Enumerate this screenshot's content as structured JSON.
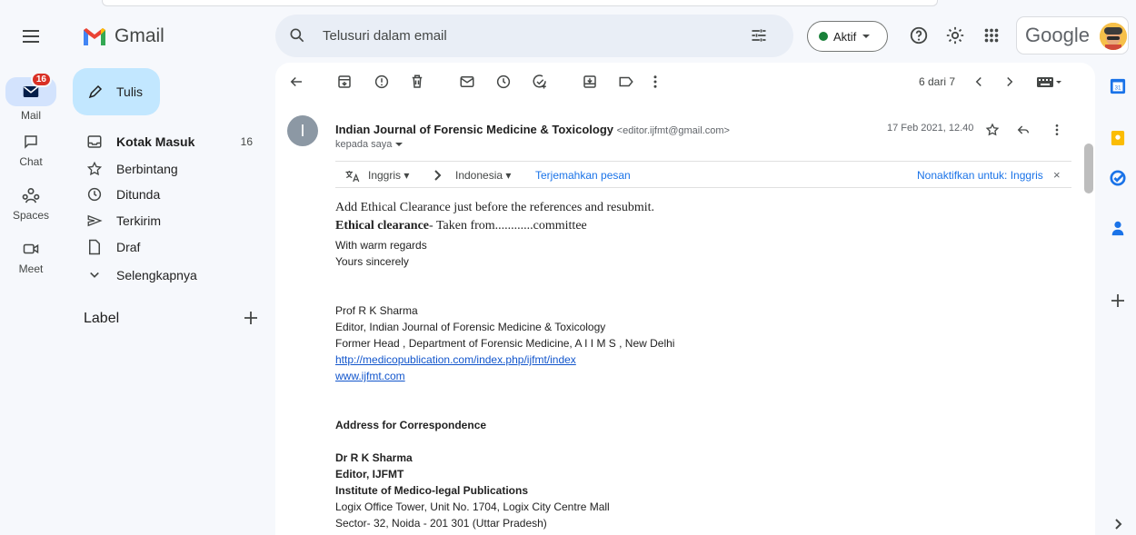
{
  "app": {
    "name": "Gmail"
  },
  "search": {
    "placeholder": "Telusuri dalam email"
  },
  "status": {
    "label": "Aktif"
  },
  "account": {
    "label": "Google"
  },
  "rail": [
    {
      "label": "Mail",
      "badge": "16"
    },
    {
      "label": "Chat"
    },
    {
      "label": "Spaces"
    },
    {
      "label": "Meet"
    }
  ],
  "compose": {
    "label": "Tulis"
  },
  "nav": [
    {
      "label": "Kotak Masuk",
      "count": "16",
      "icon": "inbox-icon"
    },
    {
      "label": "Berbintang",
      "icon": "star-icon"
    },
    {
      "label": "Ditunda",
      "icon": "clock-icon"
    },
    {
      "label": "Terkirim",
      "icon": "send-icon"
    },
    {
      "label": "Draf",
      "icon": "draft-icon"
    },
    {
      "label": "Selengkapnya",
      "icon": "chevron-down-icon"
    }
  ],
  "labels": {
    "heading": "Label"
  },
  "toolbar": {
    "pager": "6 dari 7"
  },
  "email": {
    "avatar_letter": "I",
    "sender_name": "Indian Journal of Forensic Medicine & Toxicology",
    "sender_email": "<editor.ijfmt@gmail.com>",
    "recipient": "kepada saya",
    "date": "17 Feb 2021, 12.40",
    "translate": {
      "from": "Inggris",
      "to": "Indonesia",
      "action": "Terjemahkan pesan",
      "disable": "Nonaktifkan untuk: Inggris"
    },
    "body": {
      "l1": "Add Ethical Clearance just before the references and resubmit.",
      "l2_bold": "Ethical clearance",
      "l2_rest": "- Taken from............committee",
      "l3": "With warm regards",
      "l4": "Yours sincerely",
      "sig_name": "Prof R K Sharma",
      "sig_l2": "Editor, Indian Journal of Forensic Medicine & Toxicology",
      "sig_l3": "Former Head , Department of Forensic Medicine, A I I M S , New Delhi",
      "link1": "http://medicopublication.com/index.php/ijfmt/index",
      "link2": "www.ijfmt.com",
      "addr_head": "Address for Correspondence",
      "addr_name": "Dr R K Sharma",
      "addr_role": "Editor, IJFMT",
      "addr_org": "Institute of Medico-legal Publications",
      "addr_l1": "Logix Office Tower, Unit No. 1704, Logix City Centre Mall",
      "addr_l2": "Sector- 32, Noida - 201 301 (Uttar Pradesh)"
    }
  }
}
